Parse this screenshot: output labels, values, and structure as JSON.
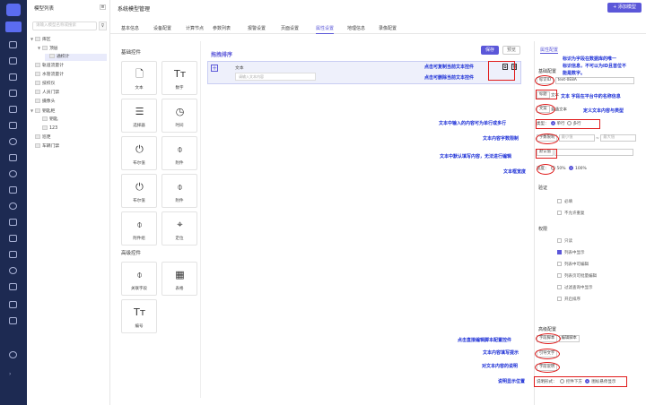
{
  "tree": {
    "title": "模型列表",
    "search_placeholder": "请输入模型名称或搜索",
    "nodes": [
      {
        "label": "库区",
        "level": 0,
        "arrow": "▼"
      },
      {
        "label": "顶层",
        "level": 1,
        "arrow": "▼"
      },
      {
        "label": "通校计",
        "level": 2,
        "arrow": "",
        "selected": true
      },
      {
        "label": "轨道流量计",
        "level": 0,
        "arrow": ""
      },
      {
        "label": "水管流量计",
        "level": 0,
        "arrow": ""
      },
      {
        "label": "技校仪",
        "level": 0,
        "arrow": ""
      },
      {
        "label": "人员门禁",
        "level": 0,
        "arrow": ""
      },
      {
        "label": "摄像头",
        "level": 0,
        "arrow": ""
      },
      {
        "label": "钥匙柜",
        "level": 0,
        "arrow": "▼"
      },
      {
        "label": "钥匙",
        "level": 1,
        "arrow": ""
      },
      {
        "label": "123",
        "level": 1,
        "arrow": ""
      },
      {
        "label": "巡更",
        "level": 0,
        "arrow": ""
      },
      {
        "label": "车辆门禁",
        "level": 0,
        "arrow": ""
      }
    ]
  },
  "header": {
    "title": "系统模型管理",
    "add_button": "+ 添加模型"
  },
  "tabs": [
    "基本信息",
    "设备配置",
    "计算节点",
    "参数列表",
    "报警设置",
    "页面设置",
    "属性设置",
    "地理信息",
    "录像配置"
  ],
  "active_tab": "属性设置",
  "basic_controls": {
    "title": "基础控件",
    "items": [
      "文本",
      "数字",
      "选择器",
      "时间",
      "布尔值",
      "附件",
      "布尔值",
      "附件",
      "附件组",
      "定位"
    ]
  },
  "advanced_controls": {
    "title": "高级控件",
    "items": [
      "关联字段",
      "表格",
      "编号"
    ]
  },
  "canvas": {
    "sort_label": "拖拽排序",
    "save": "保存",
    "preview": "预览",
    "field_label": "文本",
    "field_placeholder": "请输入文本内容"
  },
  "props": {
    "tab": "属性配置",
    "basic_title": "基础配置",
    "id_label": "标识ID",
    "id_value": "text-0E8A",
    "name_label": "标题",
    "name_value": "文本",
    "default_label": "文案",
    "default_value": "普通文本",
    "type_label": "类型",
    "type_single": "单行",
    "type_multi": "多行",
    "limit_label": "字数限制",
    "min_ph": "最小值",
    "max_ph": "最大值",
    "default_val_label": "默认值",
    "width_label": "宽度",
    "width_50": "50%",
    "width_100": "100%",
    "valid_title": "验证",
    "valid_items": [
      "必填",
      "不允许重复"
    ],
    "perm_title": "权限",
    "perm_items": [
      "只读",
      "列表中显示",
      "列表中可编辑",
      "列表页可批量编辑",
      "过滤查询中显示",
      "开启排序"
    ],
    "adv_title": "高级配置",
    "adv_btn1": "字段脚本",
    "adv_btn2": "编辑脚本",
    "guide_label": "引导文字",
    "desc_label": "字段说明",
    "desc_pos_label": "说明形式：",
    "desc_pos_a": "控件下方",
    "desc_pos_b": "图标悬停显示"
  },
  "annotations": {
    "a1": "标识为字段在数据库的唯一",
    "a1b": "标识信息，不可以为ID且首位不",
    "a1c": "能是数字。",
    "a2": "点击可复制当前文本控件",
    "a3": "点击可删除当前文本控件",
    "a4": "文本 字段在平台中的名称信息",
    "a5": "定义文本内容与类型",
    "a6": "文本中输入的内容可为单行或多行",
    "a7": "文本内容字数限制",
    "a8": "文本中默认填写内容，无法进行编辑",
    "a9": "文本框宽度",
    "a10": "点击直接编辑脚本配置控件",
    "a11": "文本内容填写提示",
    "a12": "对文本内容的说明",
    "a13": "说明显示位置"
  },
  "colors": {
    "accent": "#5b57d9",
    "rail": "#1d2a52",
    "annotation": "#1a2dd6",
    "highlight": "#e01b1b"
  }
}
